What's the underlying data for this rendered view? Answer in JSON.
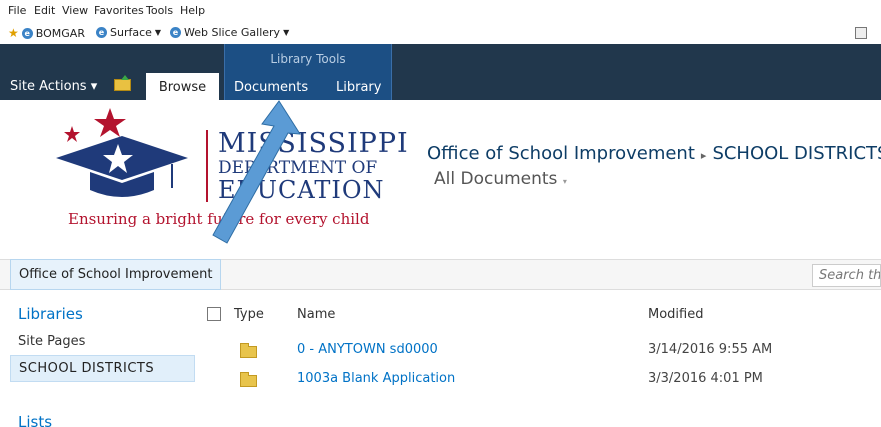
{
  "browser": {
    "menu": [
      "File",
      "Edit",
      "View",
      "Favorites",
      "Tools",
      "Help"
    ],
    "favorites": [
      {
        "label": "BOMGAR",
        "dropdown": false
      },
      {
        "label": "Surface",
        "dropdown": true
      },
      {
        "label": "Web Slice Gallery",
        "dropdown": true
      }
    ]
  },
  "ribbon": {
    "contextual_group": "Library Tools",
    "site_actions": "Site Actions",
    "site_actions_caret": "▾",
    "tabs": {
      "browse": "Browse",
      "documents": "Documents",
      "library": "Library"
    }
  },
  "logo": {
    "line1": "MISSISSIPPI",
    "line2": "DEPARTMENT OF",
    "line3": "EDUCATION",
    "tagline": "Ensuring a bright future for every child"
  },
  "header": {
    "site": "Office of School Improvement",
    "separator": "▸",
    "library": "SCHOOL DISTRICTS",
    "view": "All Documents",
    "view_caret": "▾"
  },
  "breadcrumb_bar": {
    "home": "Office of School Improvement",
    "search_placeholder": "Search this site..."
  },
  "quick_launch": {
    "libraries_heading": "Libraries",
    "items": [
      "Site Pages",
      "SCHOOL DISTRICTS"
    ],
    "lists_heading": "Lists"
  },
  "list": {
    "columns": {
      "type": "Type",
      "name": "Name",
      "modified": "Modified"
    },
    "rows": [
      {
        "name": "0 - ANYTOWN sd0000",
        "modified": "3/14/2016 9:55 AM"
      },
      {
        "name": "1003a Blank Application",
        "modified": "3/3/2016 4:01 PM"
      }
    ]
  },
  "colors": {
    "ribbon_bg": "#21374c",
    "contextual_tab": "#1c4f84",
    "link_blue": "#0072c6",
    "annotation_arrow": "#5b9bd5",
    "logo_red": "#b3132e",
    "logo_navy": "#1f3a7a"
  }
}
